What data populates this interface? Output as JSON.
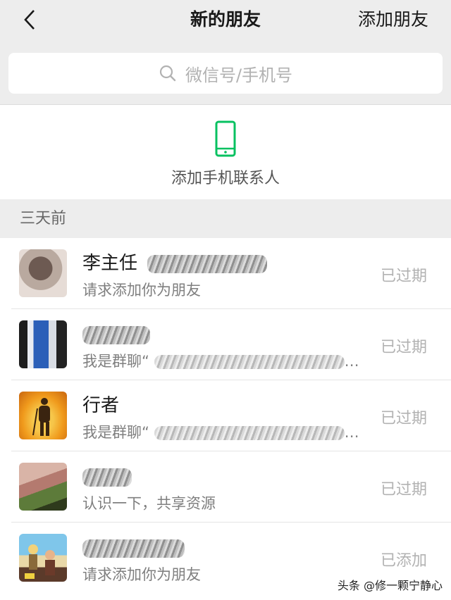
{
  "nav": {
    "title": "新的朋友",
    "add_label": "添加朋友"
  },
  "search": {
    "placeholder": "微信号/手机号"
  },
  "phone_contacts": {
    "label": "添加手机联系人"
  },
  "section": {
    "header": "三天前"
  },
  "requests": [
    {
      "name": "李主任",
      "message": "请求添加你为朋友",
      "status": "已过期"
    },
    {
      "name": "",
      "message": "我是群聊“",
      "status": "已过期"
    },
    {
      "name": "行者",
      "message": "我是群聊“",
      "status": "已过期"
    },
    {
      "name": "",
      "message": "认识一下，共享资源",
      "status": "已过期"
    },
    {
      "name": "",
      "message": "请求添加你为朋友",
      "status": "已添加"
    }
  ],
  "watermark": "头条 @修一颗宁静心",
  "colors": {
    "accent_green": "#07c160",
    "status_gray": "#b2b2b2"
  }
}
